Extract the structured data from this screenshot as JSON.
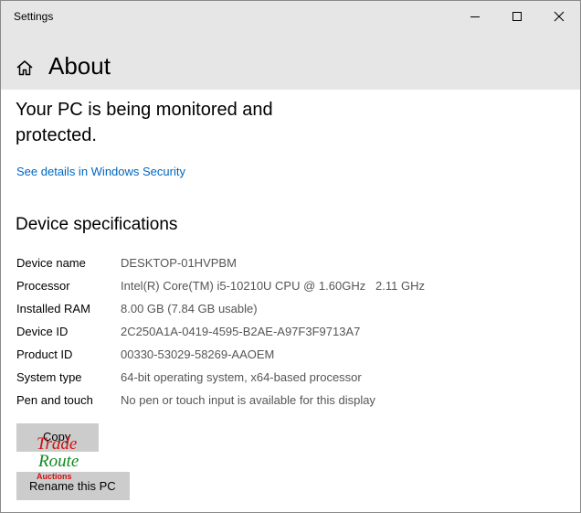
{
  "window": {
    "title": "Settings",
    "controls": [
      "minimize-icon",
      "maximize-icon",
      "close-icon"
    ]
  },
  "header": {
    "title": "About",
    "icon": "home-icon"
  },
  "security": {
    "status_text": "Your PC is being monitored and protected.",
    "link": "See details in Windows Security"
  },
  "specs": {
    "heading": "Device specifications",
    "rows": [
      {
        "label": "Device name",
        "value": "DESKTOP-01HVPBM"
      },
      {
        "label": "Processor",
        "value": "Intel(R) Core(TM) i5-10210U CPU @ 1.60GHz   2.11 GHz"
      },
      {
        "label": "Installed RAM",
        "value": "8.00 GB (7.84 GB usable)"
      },
      {
        "label": "Device ID",
        "value": "2C250A1A-0419-4595-B2AE-A97F3F9713A7"
      },
      {
        "label": "Product ID",
        "value": "00330-53029-58269-AAOEM"
      },
      {
        "label": "System type",
        "value": "64-bit operating system, x64-based processor"
      },
      {
        "label": "Pen and touch",
        "value": "No pen or touch input is available for this display"
      }
    ]
  },
  "buttons": {
    "copy": "Copy",
    "rename": "Rename this PC"
  },
  "watermark": {
    "lines": [
      "Trade",
      "Route",
      "Auctions"
    ]
  },
  "colors": {
    "header_bg": "#e6e6e6",
    "link": "#0067c0",
    "button_bg": "#cccccc",
    "value_text": "#555555"
  }
}
